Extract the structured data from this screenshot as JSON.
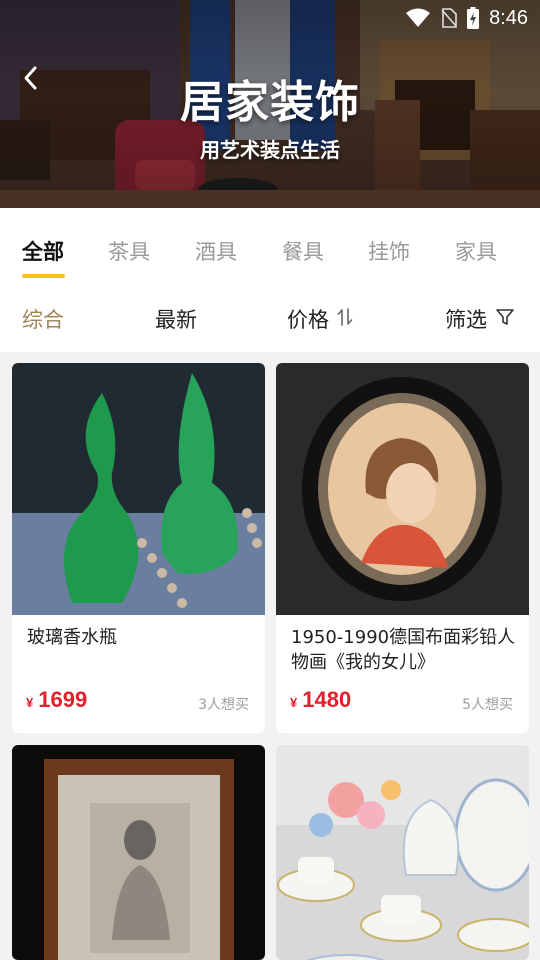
{
  "status_bar": {
    "time": "8:46",
    "icons": [
      "wifi-icon",
      "no-sim-icon",
      "battery-charging-icon"
    ]
  },
  "hero": {
    "title": "居家装饰",
    "subtitle": "用艺术装点生活",
    "back_icon": "chevron-left-icon"
  },
  "tabs": [
    {
      "label": "全部",
      "active": true
    },
    {
      "label": "茶具",
      "active": false
    },
    {
      "label": "酒具",
      "active": false
    },
    {
      "label": "餐具",
      "active": false
    },
    {
      "label": "挂饰",
      "active": false
    },
    {
      "label": "家具",
      "active": false
    }
  ],
  "sort": {
    "overall": "综合",
    "newest": "最新",
    "price": "价格",
    "filter": "筛选",
    "price_icon": "sort-arrows-icon",
    "filter_icon": "filter-funnel-icon"
  },
  "products": [
    {
      "title": "玻璃香水瓶",
      "currency": "¥",
      "price": "1699",
      "wants": "3人想买"
    },
    {
      "title": "1950-1990德国布面彩铅人物画《我的女儿》",
      "currency": "¥",
      "price": "1480",
      "wants": "5人想买"
    },
    {
      "title": "",
      "currency": "",
      "price": "",
      "wants": ""
    },
    {
      "title": "",
      "currency": "",
      "price": "",
      "wants": ""
    }
  ],
  "colors": {
    "accent_yellow": "#f5c518",
    "price_red": "#e0202b",
    "active_sort": "#a08358"
  }
}
